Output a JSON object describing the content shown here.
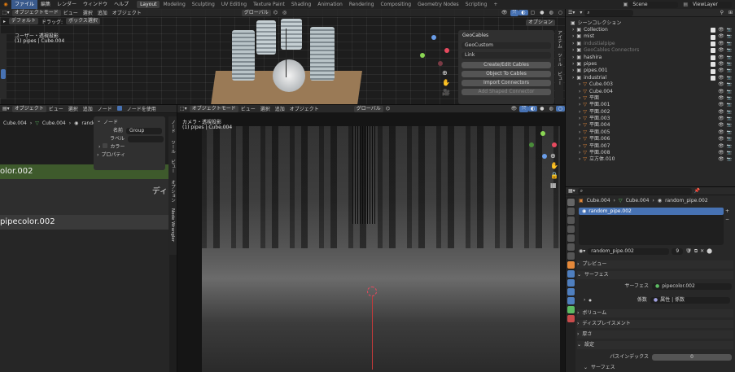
{
  "topbar": {
    "menus": [
      "ファイル",
      "編集",
      "レンダー",
      "ウィンドウ",
      "ヘルプ"
    ],
    "workspaces": [
      "Layout",
      "Modeling",
      "Sculpting",
      "UV Editing",
      "Texture Paint",
      "Shading",
      "Animation",
      "Rendering",
      "Compositing",
      "Geometry Nodes",
      "Scripting"
    ],
    "add_tab": "+",
    "scene": "Scene",
    "view_layer": "ViewLayer"
  },
  "viewport_top": {
    "mode": "オブジェクトモード",
    "menus": [
      "ビュー",
      "選択",
      "追加",
      "オブジェクト"
    ],
    "orientation": "グローバル",
    "sub_header": [
      "デフォルト",
      "ドラッグ:",
      "ボックス選択"
    ],
    "options": "オプション",
    "view_name": "ユーザー・透視投影",
    "collection_info": "(1) pipes | Cube.004"
  },
  "geocables": {
    "title": "GeoCables",
    "label1": "GeoCustom",
    "label2": "Link",
    "buttons": [
      "Create/Edit Cables",
      "Object To Cables",
      "Import Connectors",
      "Add Shaped Connector"
    ],
    "side_tabs": [
      "アイテム",
      "ツール",
      "ビュー"
    ]
  },
  "node_editor": {
    "mode": "オブジェクト",
    "menus": [
      "ビュー",
      "選択",
      "追加",
      "ノード"
    ],
    "use_nodes": "ノードを使用",
    "breadcrumb": [
      "Cube.004",
      "Cube.004",
      "random_..."
    ],
    "node_panel_title": "ノード",
    "name_label": "名前",
    "name_value": "Group",
    "label_label": "ラベル",
    "color_label": "カラー",
    "properties_label": "プロパティ",
    "node_top_title": "olor.002",
    "node_side_text": "ディ",
    "node_bottom_title": "pipecolor.002",
    "side_tabs": [
      "ノード",
      "ツール",
      "ビュー",
      "オプション",
      "Node Wrangler"
    ]
  },
  "camera_view": {
    "mode": "オブジェクトモード",
    "menus": [
      "ビュー",
      "選択",
      "追加",
      "オブジェクト"
    ],
    "orientation": "グローバル",
    "view_name": "カメラ・透視投影",
    "collection_info": "(1) pipes | Cube.004"
  },
  "outliner": {
    "title": "シーンコレクション",
    "search_placeholder": "",
    "items": [
      {
        "label": "Collection",
        "indent": 1,
        "color": "#cfcfcf",
        "kind": "collection"
      },
      {
        "label": "mist",
        "indent": 1,
        "color": "#cfcfcf",
        "kind": "collection"
      },
      {
        "label": "industialpipe",
        "indent": 1,
        "color": "#7a7a7a",
        "kind": "collection"
      },
      {
        "label": "GeoCables Connectors",
        "indent": 1,
        "color": "#7a7a7a",
        "kind": "collection"
      },
      {
        "label": "hashira",
        "indent": 1,
        "color": "#cfcfcf",
        "kind": "collection"
      },
      {
        "label": "pipes",
        "indent": 1,
        "color": "#cfcfcf",
        "kind": "collection"
      },
      {
        "label": "pipes.001",
        "indent": 1,
        "color": "#cfcfcf",
        "kind": "collection"
      },
      {
        "label": "industrial",
        "indent": 1,
        "color": "#cfcfcf",
        "kind": "collection"
      },
      {
        "label": "Cube.003",
        "indent": 2,
        "color": "#cfcfcf",
        "kind": "mesh"
      },
      {
        "label": "Cube.004",
        "indent": 2,
        "color": "#cfcfcf",
        "kind": "mesh"
      },
      {
        "label": "平面",
        "indent": 2,
        "color": "#cfcfcf",
        "kind": "mesh"
      },
      {
        "label": "平面.001",
        "indent": 2,
        "color": "#cfcfcf",
        "kind": "mesh"
      },
      {
        "label": "平面.002",
        "indent": 2,
        "color": "#cfcfcf",
        "kind": "mesh"
      },
      {
        "label": "平面.003",
        "indent": 2,
        "color": "#cfcfcf",
        "kind": "mesh"
      },
      {
        "label": "平面.004",
        "indent": 2,
        "color": "#cfcfcf",
        "kind": "mesh"
      },
      {
        "label": "平面.005",
        "indent": 2,
        "color": "#cfcfcf",
        "kind": "mesh"
      },
      {
        "label": "平面.006",
        "indent": 2,
        "color": "#cfcfcf",
        "kind": "mesh"
      },
      {
        "label": "平面.007",
        "indent": 2,
        "color": "#cfcfcf",
        "kind": "mesh"
      },
      {
        "label": "平面.008",
        "indent": 2,
        "color": "#cfcfcf",
        "kind": "mesh"
      },
      {
        "label": "立方体.010",
        "indent": 2,
        "color": "#cfcfcf",
        "kind": "mesh"
      }
    ]
  },
  "properties": {
    "breadcrumb": [
      "Cube.004",
      "Cube.004",
      "random_pipe.002"
    ],
    "slot": "random_pipe.002",
    "material": "random_pipe.002",
    "user_count": "9",
    "sections": {
      "preview": "プレビュー",
      "surface": "サーフェス",
      "surface_label": "サーフェス",
      "surface_value": "pipecolor.002",
      "coeff_label": "係数",
      "coeff_value": "属性 | 係数",
      "coeff_dot": "●",
      "volume": "ボリューム",
      "displacement": "ディスプレイスメント",
      "thickness": "厚さ",
      "settings": "設定",
      "pass_index_label": "パスインデックス",
      "pass_index_value": "0",
      "surface2": "サーフェス"
    }
  },
  "colors": {
    "accent": "#4772b3",
    "node_header_green": "#3e5a2c",
    "orange": "#e5893a"
  }
}
